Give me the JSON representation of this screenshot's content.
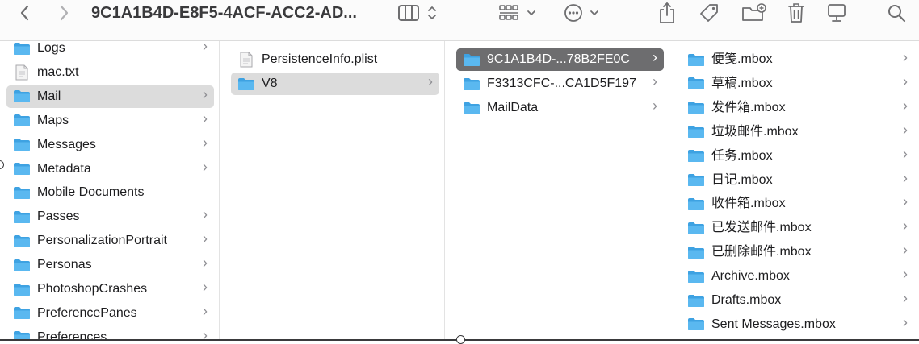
{
  "window": {
    "title": "9C1A1B4D-E8F5-4ACF-ACC2-AD..."
  },
  "toolbar": {
    "back_icon": "chevron-left-icon",
    "forward_icon": "chevron-right-icon",
    "view_icon": "columns-view-icon",
    "group_icon": "group-grid-icon",
    "action_icon": "ellipsis-circle-icon",
    "share_icon": "share-icon",
    "tag_icon": "tag-icon",
    "new_folder_icon": "new-folder-icon",
    "trash_icon": "trash-icon",
    "desktop_icon": "desktop-icon",
    "search_icon": "search-icon"
  },
  "column1": {
    "items": [
      {
        "label": "Logs",
        "type": "folder",
        "has_children": true
      },
      {
        "label": "mac.txt",
        "type": "file",
        "has_children": false
      },
      {
        "label": "Mail",
        "type": "folder",
        "has_children": true,
        "selected": true
      },
      {
        "label": "Maps",
        "type": "folder",
        "has_children": true
      },
      {
        "label": "Messages",
        "type": "folder",
        "has_children": true
      },
      {
        "label": "Metadata",
        "type": "folder",
        "has_children": true
      },
      {
        "label": "Mobile Documents",
        "type": "folder",
        "has_children": false
      },
      {
        "label": "Passes",
        "type": "folder",
        "has_children": true
      },
      {
        "label": "PersonalizationPortrait",
        "type": "folder",
        "has_children": true
      },
      {
        "label": "Personas",
        "type": "folder",
        "has_children": true
      },
      {
        "label": "PhotoshopCrashes",
        "type": "folder",
        "has_children": true
      },
      {
        "label": "PreferencePanes",
        "type": "folder",
        "has_children": true
      },
      {
        "label": "Preferences",
        "type": "folder",
        "has_children": true
      }
    ]
  },
  "column2": {
    "items": [
      {
        "label": "PersistenceInfo.plist",
        "type": "file",
        "has_children": false
      },
      {
        "label": "V8",
        "type": "folder",
        "has_children": true,
        "selected": true
      }
    ]
  },
  "column3": {
    "items": [
      {
        "label": "9C1A1B4D-...78B2FE0C",
        "type": "folder",
        "has_children": true,
        "selected": true
      },
      {
        "label": "F3313CFC-...CA1D5F197",
        "type": "folder",
        "has_children": true
      },
      {
        "label": "MailData",
        "type": "folder",
        "has_children": true
      }
    ]
  },
  "column4": {
    "items": [
      {
        "label": "便笺.mbox",
        "type": "folder",
        "has_children": true
      },
      {
        "label": "草稿.mbox",
        "type": "folder",
        "has_children": true
      },
      {
        "label": "发件箱.mbox",
        "type": "folder",
        "has_children": true
      },
      {
        "label": "垃圾邮件.mbox",
        "type": "folder",
        "has_children": true
      },
      {
        "label": "任务.mbox",
        "type": "folder",
        "has_children": true
      },
      {
        "label": "日记.mbox",
        "type": "folder",
        "has_children": true
      },
      {
        "label": "收件箱.mbox",
        "type": "folder",
        "has_children": true
      },
      {
        "label": "已发送邮件.mbox",
        "type": "folder",
        "has_children": true
      },
      {
        "label": "已删除邮件.mbox",
        "type": "folder",
        "has_children": true
      },
      {
        "label": "Archive.mbox",
        "type": "folder",
        "has_children": true
      },
      {
        "label": "Drafts.mbox",
        "type": "folder",
        "has_children": true
      },
      {
        "label": "Sent Messages.mbox",
        "type": "folder",
        "has_children": true
      }
    ]
  },
  "colors": {
    "folder_blue": "#5ab8f0",
    "folder_blue_dark": "#3ea2e2",
    "selected_grey": "#dcdcdc",
    "selected_dark": "#6d6d6f"
  }
}
